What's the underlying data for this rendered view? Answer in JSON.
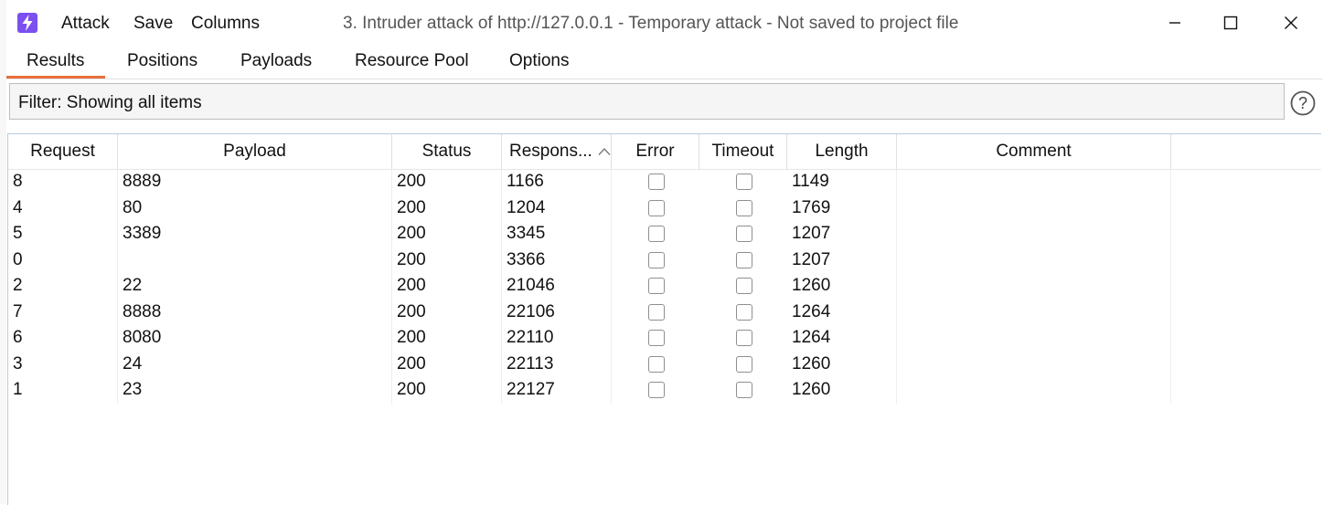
{
  "menu": {
    "attack": "Attack",
    "save": "Save",
    "columns": "Columns"
  },
  "window_title": "3. Intruder attack of http://127.0.0.1 - Temporary attack - Not saved to project file",
  "tabs": [
    {
      "label": "Results",
      "active": true
    },
    {
      "label": "Positions",
      "active": false
    },
    {
      "label": "Payloads",
      "active": false
    },
    {
      "label": "Resource Pool",
      "active": false
    },
    {
      "label": "Options",
      "active": false
    }
  ],
  "filter": {
    "text": "Filter: Showing all items"
  },
  "table": {
    "columns": [
      "Request",
      "Payload",
      "Status",
      "Respons...",
      "Error",
      "Timeout",
      "Length",
      "Comment"
    ],
    "sorted_column": "Respons...",
    "rows": [
      {
        "request": "8",
        "payload": "8889",
        "status": "200",
        "response": "1166",
        "error": false,
        "timeout": false,
        "length": "1149",
        "comment": ""
      },
      {
        "request": "4",
        "payload": "80",
        "status": "200",
        "response": "1204",
        "error": false,
        "timeout": false,
        "length": "1769",
        "comment": ""
      },
      {
        "request": "5",
        "payload": "3389",
        "status": "200",
        "response": "3345",
        "error": false,
        "timeout": false,
        "length": "1207",
        "comment": ""
      },
      {
        "request": "0",
        "payload": "",
        "status": "200",
        "response": "3366",
        "error": false,
        "timeout": false,
        "length": "1207",
        "comment": ""
      },
      {
        "request": "2",
        "payload": "22",
        "status": "200",
        "response": "21046",
        "error": false,
        "timeout": false,
        "length": "1260",
        "comment": ""
      },
      {
        "request": "7",
        "payload": "8888",
        "status": "200",
        "response": "22106",
        "error": false,
        "timeout": false,
        "length": "1264",
        "comment": ""
      },
      {
        "request": "6",
        "payload": "8080",
        "status": "200",
        "response": "22110",
        "error": false,
        "timeout": false,
        "length": "1264",
        "comment": ""
      },
      {
        "request": "3",
        "payload": "24",
        "status": "200",
        "response": "22113",
        "error": false,
        "timeout": false,
        "length": "1260",
        "comment": ""
      },
      {
        "request": "1",
        "payload": "23",
        "status": "200",
        "response": "22127",
        "error": false,
        "timeout": false,
        "length": "1260",
        "comment": ""
      }
    ]
  },
  "colors": {
    "logo": "#7b4ff0",
    "active_tab_underline": "#e8703a",
    "table_border": "#b9cbe0"
  },
  "icons": {
    "logo": "lightning-bolt-icon",
    "minimize": "minimize-icon",
    "maximize": "maximize-icon",
    "close": "close-icon",
    "help": "help-question-icon",
    "sort": "sort-ascending-icon"
  }
}
